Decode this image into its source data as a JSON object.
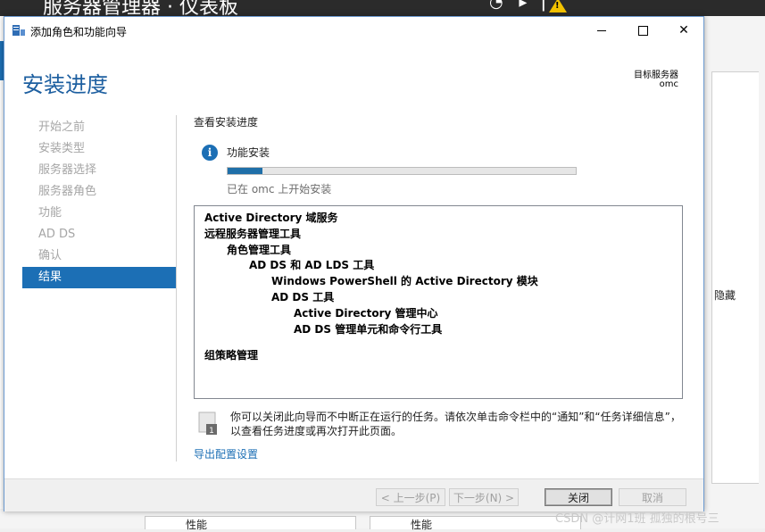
{
  "background": {
    "app_title": "服务器管理器 · 仪表板",
    "hide_label": "隐藏",
    "tile_labels": [
      "性能",
      "性能"
    ],
    "warning_icon": "warning-icon"
  },
  "dialog": {
    "title": "添加角色和功能向导",
    "heading": "安装进度",
    "target_server_label": "目标服务器",
    "target_server_value": "omc",
    "nav": [
      {
        "label": "开始之前",
        "active": false
      },
      {
        "label": "安装类型",
        "active": false
      },
      {
        "label": "服务器选择",
        "active": false
      },
      {
        "label": "服务器角色",
        "active": false
      },
      {
        "label": "功能",
        "active": false
      },
      {
        "label": "AD DS",
        "active": false
      },
      {
        "label": "确认",
        "active": false
      },
      {
        "label": "结果",
        "active": true
      }
    ],
    "content_title": "查看安装进度",
    "feature_install_label": "功能安装",
    "progress_fraction": 0.1,
    "status_text": "已在 omc 上开始安装",
    "results": [
      {
        "text": "Active Directory 域服务",
        "level": 0
      },
      {
        "text": "远程服务器管理工具",
        "level": 0
      },
      {
        "text": "角色管理工具",
        "level": 1
      },
      {
        "text": "AD DS 和 AD LDS 工具",
        "level": 2
      },
      {
        "text": "Windows PowerShell 的 Active Directory 模块",
        "level": 3
      },
      {
        "text": "AD DS 工具",
        "level": 3
      },
      {
        "text": "Active Directory 管理中心",
        "level": 4
      },
      {
        "text": "AD DS 管理单元和命令行工具",
        "level": 4
      },
      {
        "text": "组策略管理",
        "level": 0
      }
    ],
    "note_text": "你可以关闭此向导而不中断正在运行的任务。请依次单击命令栏中的“通知”和“任务详细信息”，以查看任务进度或再次打开此页面。",
    "note_badge": "1",
    "export_link": "导出配置设置",
    "buttons": {
      "previous": "< 上一步(P)",
      "next": "下一步(N) >",
      "close": "关闭",
      "cancel": "取消"
    }
  },
  "watermark": "CSDN @计网1班 孤独的根号三"
}
